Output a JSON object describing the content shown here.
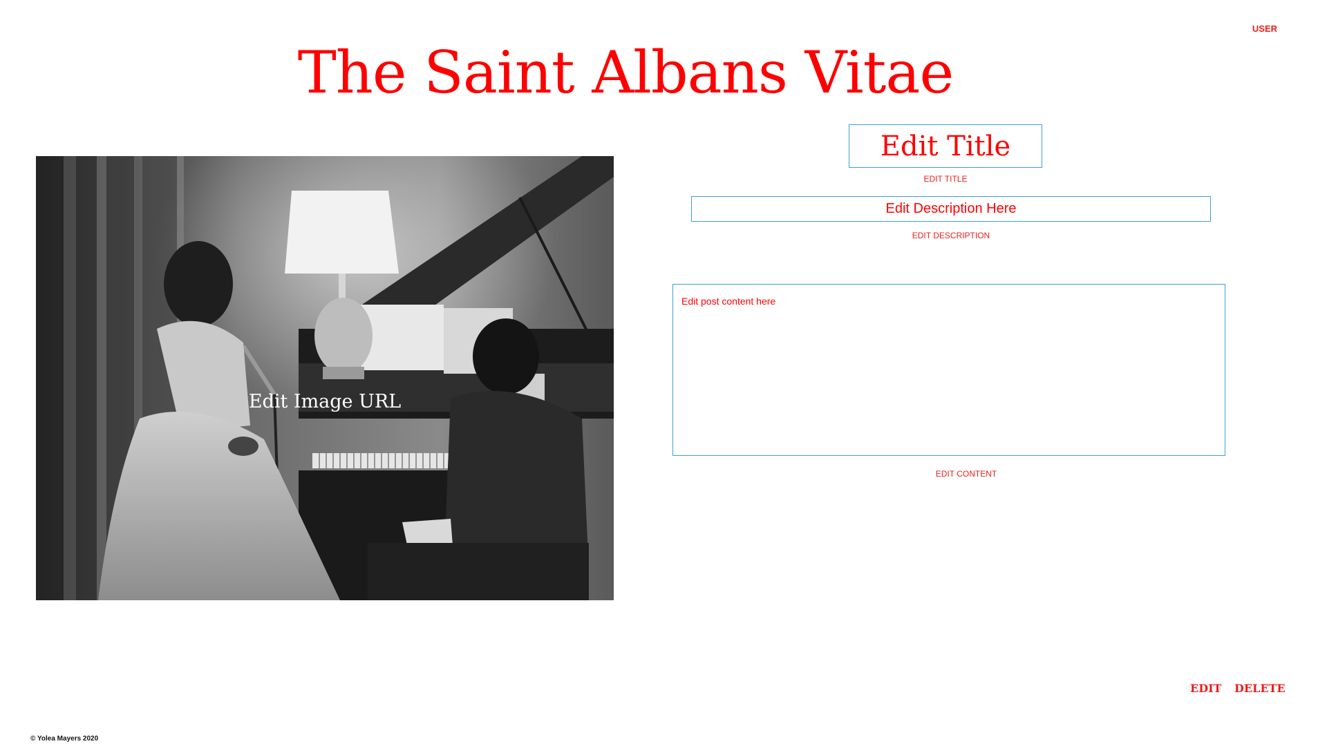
{
  "header": {
    "user_link": "USER",
    "site_title": "The Saint Albans Vitae"
  },
  "post_image": {
    "overlay_text": "Edit Image URL",
    "description_hint": "black-and-white photo of a woman singing beside a grand piano with a pianist"
  },
  "editor": {
    "title_value": "Edit Title",
    "title_label": "EDIT TITLE",
    "description_value": "Edit Description Here",
    "description_label": "EDIT DESCRIPTION",
    "content_value": "Edit post content here",
    "content_label": "EDIT CONTENT"
  },
  "actions": {
    "edit": "EDIT",
    "delete": "DELETE"
  },
  "footer": {
    "copyright": "© Yolea Mayers 2020"
  },
  "colors": {
    "accent": "#ff0000",
    "field_border": "#3a9fe0"
  }
}
